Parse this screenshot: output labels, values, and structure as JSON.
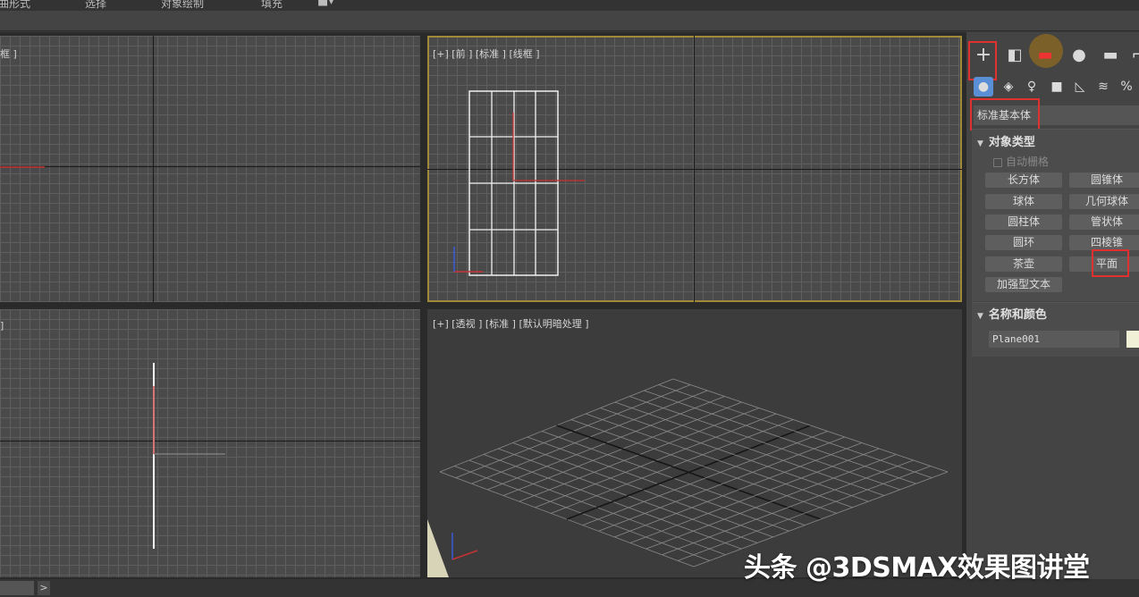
{
  "menubar": {
    "items": [
      "曲形式",
      "选择",
      "对象绘制",
      "填充"
    ]
  },
  "viewports": {
    "top_left": {
      "label": "框 ]"
    },
    "front": {
      "label": "[+] [前 ] [标准 ] [线框 ]"
    },
    "left": {
      "label": "]"
    },
    "perspective": {
      "label": "[+] [透视 ] [标准 ] [默认明暗处理 ]"
    }
  },
  "command_panel": {
    "tabs": [
      "create-icon",
      "modify-icon",
      "hierarchy-icon",
      "motion-icon",
      "display-icon",
      "utilities-icon"
    ],
    "categories": [
      "geometry-icon",
      "shapes-icon",
      "lights-icon",
      "cameras-icon",
      "helpers-icon",
      "spacewarps-icon",
      "systems-icon"
    ],
    "dropdown_value": "标准基本体",
    "object_type": {
      "header": "对象类型",
      "autogrid_label": "自动栅格",
      "buttons": [
        "长方体",
        "圆锥体",
        "球体",
        "几何球体",
        "圆柱体",
        "管状体",
        "圆环",
        "四棱锥",
        "茶壶",
        "平面",
        "加强型文本"
      ]
    },
    "name_color": {
      "header": "名称和颜色",
      "name_value": "Plane001",
      "swatch_color": "#f0f0d6"
    }
  },
  "statusbar": {
    "arrow": ">"
  },
  "watermark": "头条 @3DSMAX效果图讲堂",
  "colors": {
    "highlight_red": "#e03030",
    "active_viewport": "#a08a3a"
  }
}
